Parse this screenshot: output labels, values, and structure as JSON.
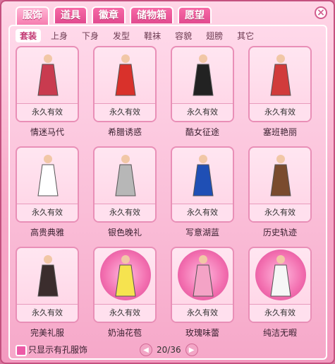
{
  "tabs": [
    {
      "label": "服饰"
    },
    {
      "label": "道具"
    },
    {
      "label": "徽章"
    },
    {
      "label": "储物箱"
    },
    {
      "label": "愿望"
    }
  ],
  "close_label": "×",
  "subtabs": [
    {
      "label": "套装"
    },
    {
      "label": "上身"
    },
    {
      "label": "下身"
    },
    {
      "label": "发型"
    },
    {
      "label": "鞋袜"
    },
    {
      "label": "容貌"
    },
    {
      "label": "翅膀"
    },
    {
      "label": "其它"
    }
  ],
  "items": [
    {
      "status": "永久有效",
      "name": "情迷马代",
      "color": "#c93b4f"
    },
    {
      "status": "永久有效",
      "name": "希腊诱惑",
      "color": "#d9312b"
    },
    {
      "status": "永久有效",
      "name": "酷女征途",
      "color": "#222222"
    },
    {
      "status": "永久有效",
      "name": "塞班艳丽",
      "color": "#d13b3b"
    },
    {
      "status": "永久有效",
      "name": "高贵典雅",
      "color": "#ffffff"
    },
    {
      "status": "永久有效",
      "name": "银色晚礼",
      "color": "#b7b7b7"
    },
    {
      "status": "永久有效",
      "name": "写意湖蓝",
      "color": "#1f4fb5"
    },
    {
      "status": "永久有效",
      "name": "历史轨迹",
      "color": "#7a4b2e"
    },
    {
      "status": "永久有效",
      "name": "完美礼服",
      "color": "#3b2d2d"
    },
    {
      "status": "永久有效",
      "name": "奶油花苞",
      "color": "#f6e34f"
    },
    {
      "status": "永久有效",
      "name": "玫瑰味蕾",
      "color": "#f4a3c6"
    },
    {
      "status": "永久有效",
      "name": "纯洁无暇",
      "color": "#f6f6f6"
    }
  ],
  "filter_label": "只显示有孔服饰",
  "pager": {
    "text": "20/36",
    "prev": "◀",
    "next": "▶"
  }
}
